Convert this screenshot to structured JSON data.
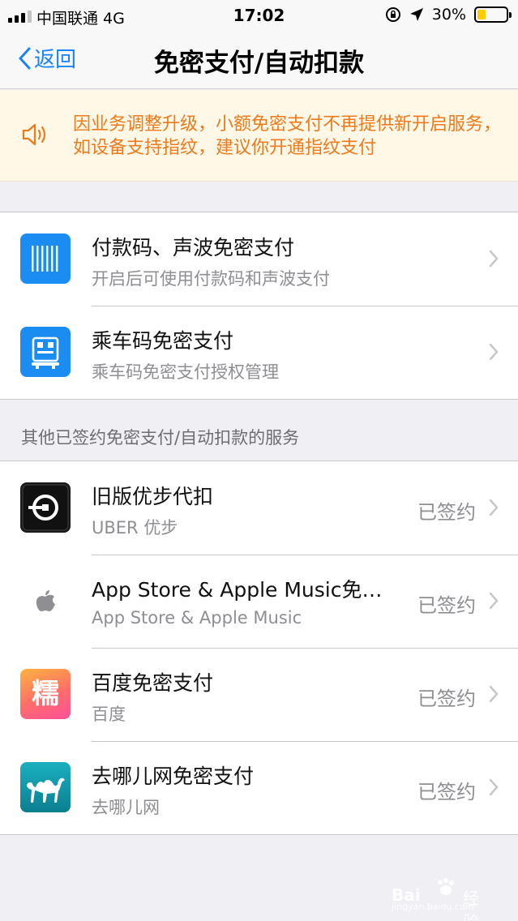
{
  "status_bar": {
    "carrier": "中国联通 4G",
    "time": "17:02",
    "battery": "30%",
    "battery_level": 0.3
  },
  "nav": {
    "back_label": "返回",
    "title": "免密支付/自动扣款"
  },
  "notice": {
    "text": "因业务调整升级，小额免密支付不再提供新开启服务，如设备支持指纹，建议你开通指纹支付"
  },
  "main_group": [
    {
      "title": "付款码、声波免密支付",
      "subtitle": "开启后可使用付款码和声波支付"
    },
    {
      "title": "乘车码免密支付",
      "subtitle": "乘车码免密支付授权管理"
    }
  ],
  "section_label": "其他已签约免密支付/自动扣款的服务",
  "services": [
    {
      "title": "旧版优步代扣",
      "subtitle": "UBER 优步",
      "status": "已签约"
    },
    {
      "title": "App Store & Apple Music免…",
      "subtitle": "App Store & Apple Music",
      "status": "已签约"
    },
    {
      "title": "百度免密支付",
      "subtitle": "百度",
      "status": "已签约"
    },
    {
      "title": "去哪儿网免密支付",
      "subtitle": "去哪儿网",
      "status": "已签约"
    }
  ],
  "baidu_icon_char": "糯",
  "watermark": {
    "brand": "Bai",
    "suffix": "经验",
    "url": "jingyan.baidu.com"
  },
  "colors": {
    "accent": "#1a82fb",
    "notice_text": "#f0791c",
    "notice_bg": "#fff8e6",
    "secondary_text": "#8e8e93"
  }
}
